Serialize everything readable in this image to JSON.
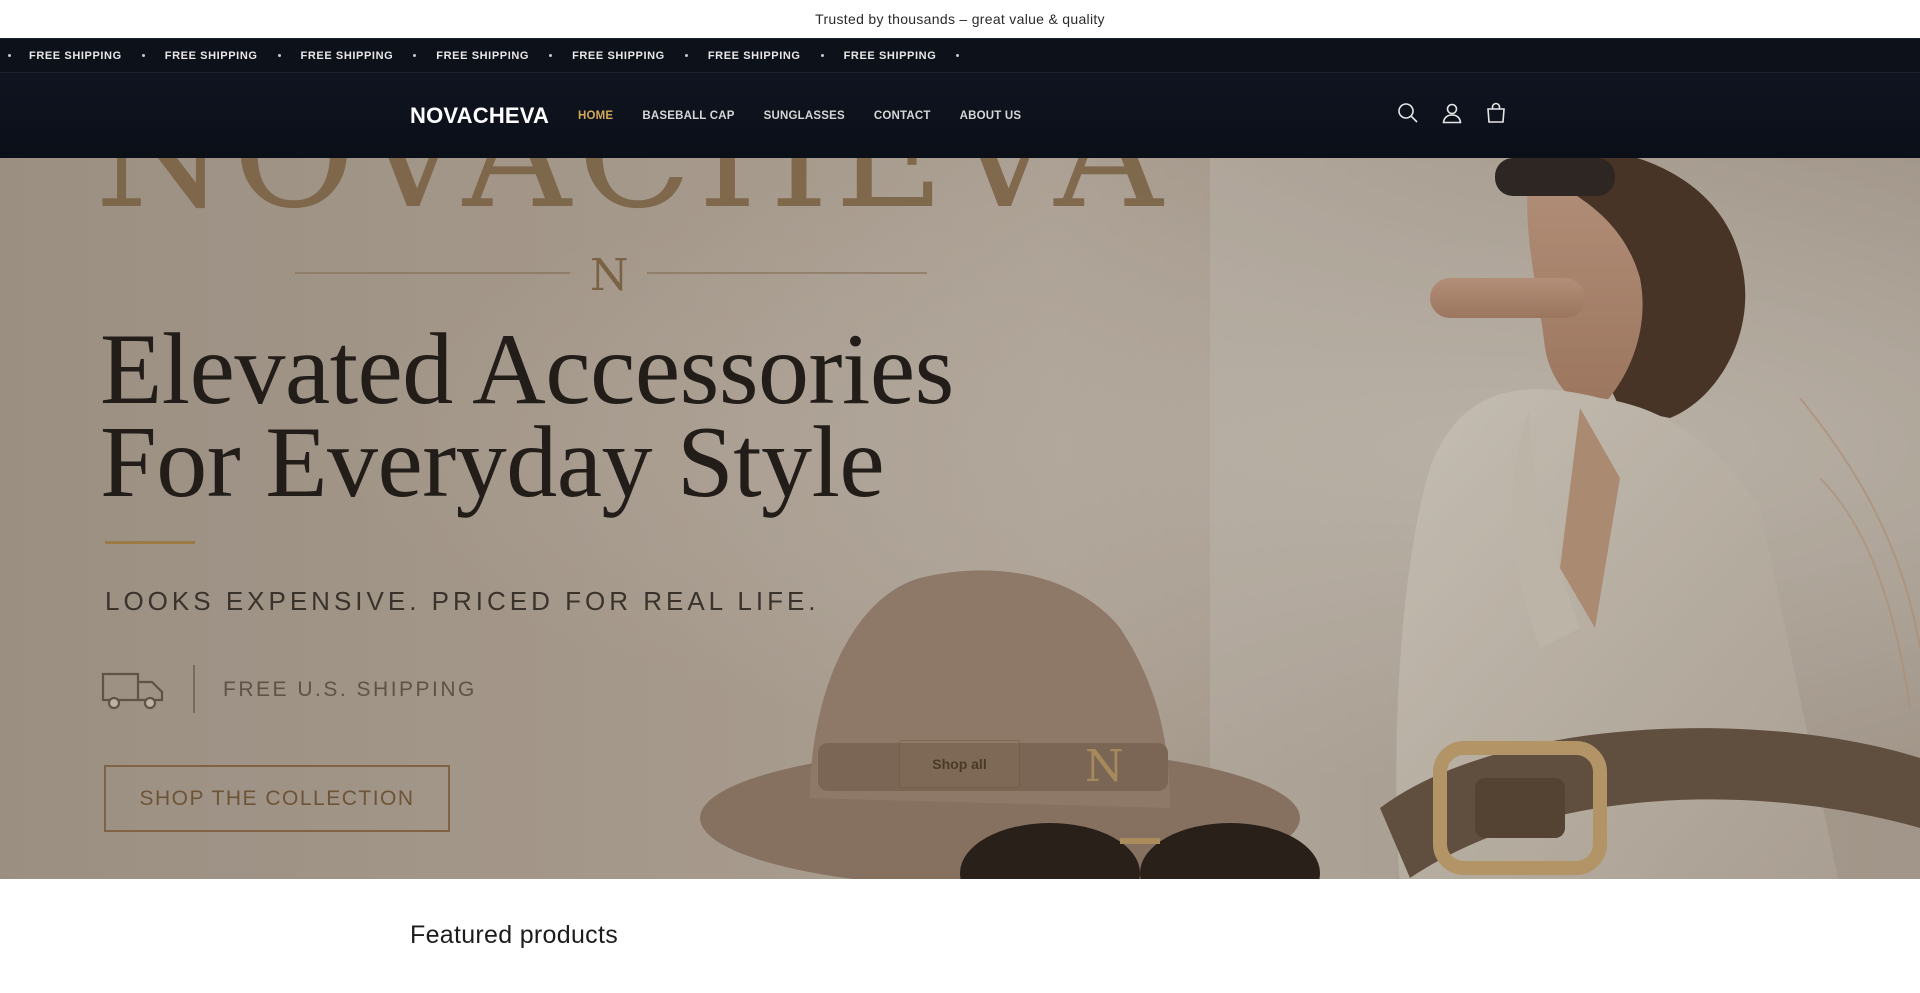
{
  "announcement": {
    "text": "Trusted by thousands – great value & quality"
  },
  "marquee": {
    "items": [
      "FREE SHIPPING",
      "FREE SHIPPING",
      "FREE SHIPPING",
      "FREE SHIPPING",
      "FREE SHIPPING",
      "FREE SHIPPING",
      "FREE SHIPPING"
    ]
  },
  "header": {
    "logo": "NOVACHEVA",
    "nav": [
      "HOME",
      "BASEBALL CAP",
      "SUNGLASSES",
      "CONTACT",
      "ABOUT US"
    ],
    "active_nav": "HOME",
    "icons": [
      "search-icon",
      "account-icon",
      "cart-icon"
    ],
    "accent_color": "#d3a95a",
    "background_color": "#0d111a"
  },
  "hero": {
    "brand_watermark": "NOVACHEVA",
    "monogram": "N",
    "headline_line1": "Elevated Accessories",
    "headline_line2": "For Everyday Style",
    "tagline": "LOOKS EXPENSIVE. PRICED FOR REAL LIFE.",
    "shipping_text": "FREE U.S. SHIPPING",
    "cta_image_text": "SHOP THE COLLECTION",
    "button_label": "Shop all"
  },
  "featured": {
    "title": "Featured products"
  }
}
